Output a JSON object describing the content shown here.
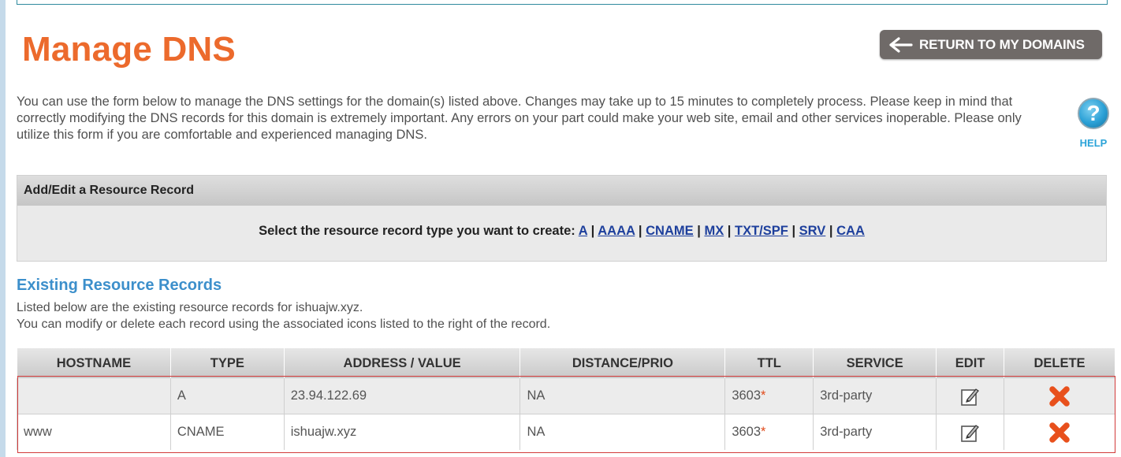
{
  "header": {
    "title": "Manage DNS",
    "return_button": "RETURN TO MY DOMAINS"
  },
  "intro": "You can use the form below to manage the DNS settings for the domain(s) listed above. Changes may take up to 15 minutes to completely process. Please keep in mind that correctly modifying the DNS records for this domain is extremely important. Any errors on your part could make your web site, email and other services inoperable. Please only utilize this form if you are comfortable and experienced managing DNS.",
  "help": {
    "glyph": "?",
    "label": "HELP"
  },
  "add_panel": {
    "title": "Add/Edit a Resource Record",
    "prompt": "Select the resource record type you want to create:",
    "types": [
      "A",
      "AAAA",
      "CNAME",
      "MX",
      "TXT/SPF",
      "SRV",
      "CAA"
    ],
    "separator": "|"
  },
  "existing": {
    "title": "Existing Resource Records",
    "line1": "Listed below are the existing resource records for ishuajw.xyz.",
    "line2": "You can modify or delete each record using the associated icons listed to the right of the record."
  },
  "table": {
    "columns": [
      "HOSTNAME",
      "TYPE",
      "ADDRESS / VALUE",
      "DISTANCE/PRIO",
      "TTL",
      "SERVICE",
      "EDIT",
      "DELETE"
    ],
    "rows": [
      {
        "hostname": "",
        "type": "A",
        "address": "23.94.122.69",
        "prio": "NA",
        "ttl": "3603",
        "ttl_mark": "*",
        "service": "3rd-party"
      },
      {
        "hostname": "www",
        "type": "CNAME",
        "address": "ishuajw.xyz",
        "prio": "NA",
        "ttl": "3603",
        "ttl_mark": "*",
        "service": "3rd-party"
      }
    ]
  },
  "icons": {
    "return": "left-arrow-icon",
    "help": "help-icon",
    "edit": "edit-icon",
    "delete": "delete-icon"
  },
  "colors": {
    "title": "#ec6a2c",
    "section_title": "#3c8fcb",
    "link": "#1d3f9c",
    "delete": "#e8501c",
    "button": "#6f6a68",
    "selection": "#d23a3a"
  }
}
